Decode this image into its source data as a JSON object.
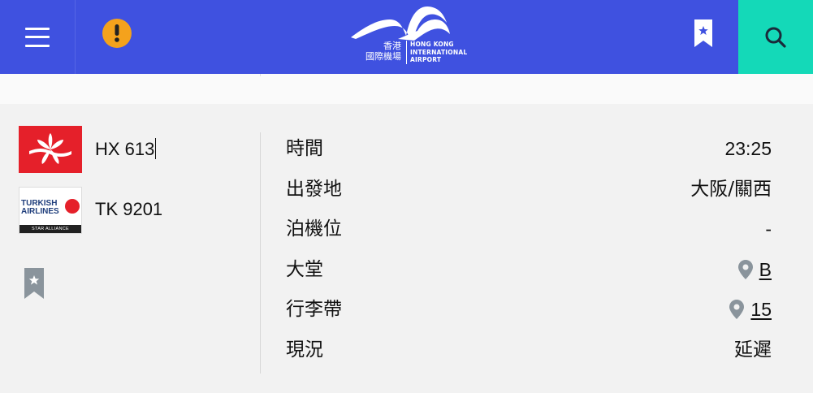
{
  "header": {
    "logo": {
      "name_cn_line1": "香港",
      "name_cn_line2": "國際機場",
      "name_en_line1": "HONG KONG",
      "name_en_line2": "INTERNATIONAL",
      "name_en_line3": "AIRPORT"
    },
    "colors": {
      "bar": "#3f51e0",
      "search": "#14d9b8",
      "alert": "#f4a21c"
    }
  },
  "flights": [
    {
      "airline_logo": "hong-kong-airlines-logo",
      "number": "HX 613"
    },
    {
      "airline_logo": "turkish-airlines-logo",
      "number": "TK 9201",
      "logo_text_1": "TURKISH",
      "logo_text_2": "AIRLINES",
      "logo_band": "STAR ALLIANCE"
    }
  ],
  "details": [
    {
      "label": "時間",
      "value": "23:25"
    },
    {
      "label": "出發地",
      "value": "大阪/關西"
    },
    {
      "label": "泊機位",
      "value": "-"
    },
    {
      "label": "大堂",
      "value": "B"
    },
    {
      "label": "行李帶",
      "value": "15"
    },
    {
      "label": "現況",
      "value": "延遲"
    }
  ]
}
